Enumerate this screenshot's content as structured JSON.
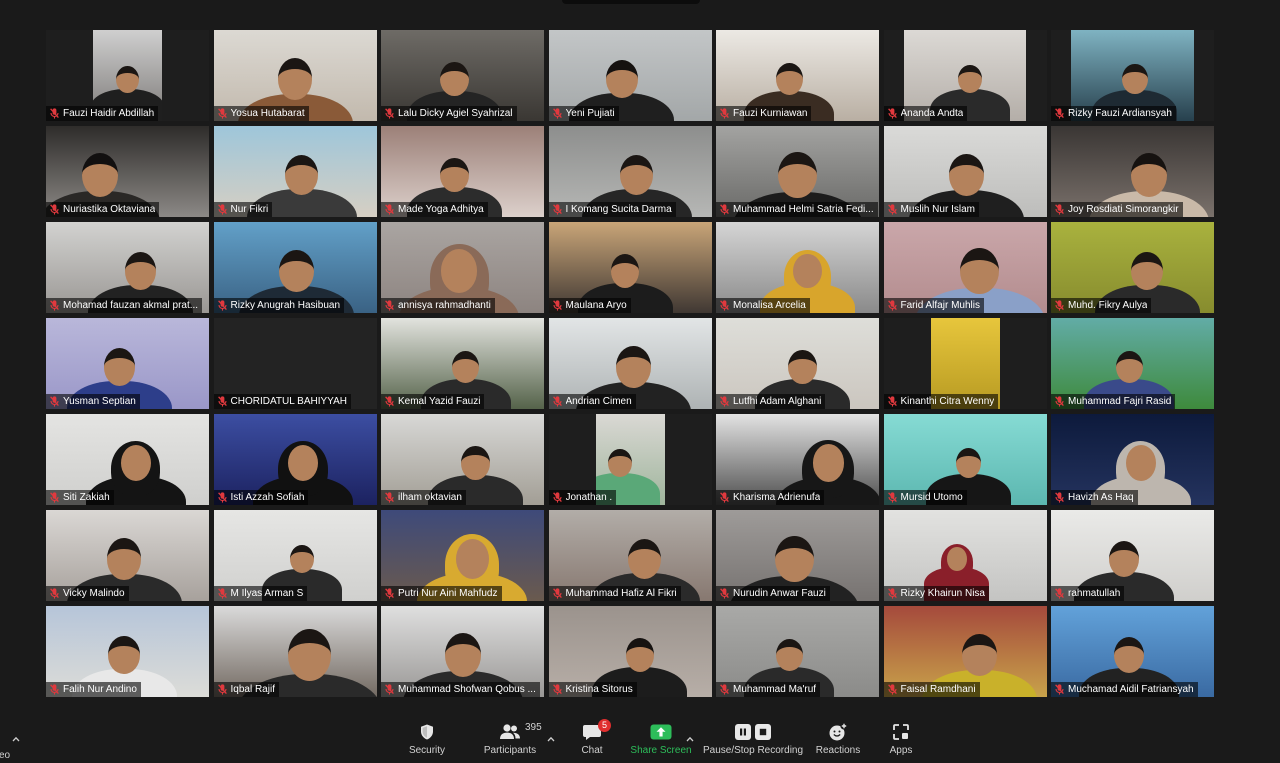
{
  "participants": [
    {
      "name": "Fauzi Haidir Abdillah",
      "muted": true
    },
    {
      "name": "Yosua Hutabarat",
      "muted": true
    },
    {
      "name": "Lalu Dicky Agiel Syahrizal",
      "muted": true
    },
    {
      "name": "Yeni Pujiati",
      "muted": true
    },
    {
      "name": "Fauzi Kurniawan",
      "muted": true
    },
    {
      "name": "Ananda Andta",
      "muted": true
    },
    {
      "name": "Rizky Fauzi Ardiansyah",
      "muted": true
    },
    {
      "name": "Nuriastika Oktaviana",
      "muted": true
    },
    {
      "name": "Nur Fikri",
      "muted": true
    },
    {
      "name": "Made Yoga Adhitya",
      "muted": true
    },
    {
      "name": "I Komang Sucita Darma",
      "muted": true
    },
    {
      "name": "Muhammad Helmi Satria Fedi...",
      "muted": true
    },
    {
      "name": "Muslih Nur Islam",
      "muted": true
    },
    {
      "name": "Joy Rosdiati Simorangkir",
      "muted": true
    },
    {
      "name": "Mohamad fauzan akmal prat...",
      "muted": true
    },
    {
      "name": "Rizky Anugrah Hasibuan",
      "muted": true
    },
    {
      "name": "annisya rahmadhanti",
      "muted": true
    },
    {
      "name": "Maulana Aryo",
      "muted": true
    },
    {
      "name": "Monalisa Arcelia",
      "muted": true
    },
    {
      "name": "Farid Alfajr Muhlis",
      "muted": true
    },
    {
      "name": "Muhd. Fikry Aulya",
      "muted": true
    },
    {
      "name": "Yusman Septian",
      "muted": true
    },
    {
      "name": "CHORIDATUL BAHIYYAH",
      "muted": true
    },
    {
      "name": "Kemal Yazid Fauzi",
      "muted": true
    },
    {
      "name": "Andrian Cimen",
      "muted": true
    },
    {
      "name": "Lutfhi Adam Alghani",
      "muted": true
    },
    {
      "name": "Kinanthi Citra Wenny",
      "muted": true
    },
    {
      "name": "Muhammad Fajri Rasid",
      "muted": true
    },
    {
      "name": "Siti Zakiah",
      "muted": true
    },
    {
      "name": "Isti Azzah Sofiah",
      "muted": true
    },
    {
      "name": "ilham oktavian",
      "muted": true
    },
    {
      "name": "Jonathan .",
      "muted": true
    },
    {
      "name": "Kharisma Adrienufa",
      "muted": true
    },
    {
      "name": "Mursid Utomo",
      "muted": true
    },
    {
      "name": "Havizh As Haq",
      "muted": true
    },
    {
      "name": "Vicky Malindo",
      "muted": true
    },
    {
      "name": "M Ilyas Arman S",
      "muted": true
    },
    {
      "name": "Putri Nur Aini Mahfudz",
      "muted": true
    },
    {
      "name": "Muhammad Hafiz Al Fikri",
      "muted": true
    },
    {
      "name": "Nurudin Anwar Fauzi",
      "muted": true
    },
    {
      "name": "Rizky Khairun Nisa",
      "muted": true
    },
    {
      "name": "rahmatullah",
      "muted": true
    },
    {
      "name": "Falih Nur Andino",
      "muted": true
    },
    {
      "name": "Iqbal Rajif",
      "muted": true
    },
    {
      "name": "Muhammad Shofwan Qobus ...",
      "muted": true
    },
    {
      "name": "Kristina Sitorus",
      "muted": true
    },
    {
      "name": "Muhammad Ma'ruf",
      "muted": true
    },
    {
      "name": "Faisal Ramdhani",
      "muted": true
    },
    {
      "name": "Muchamad Aidil Fatriansyah",
      "muted": true
    }
  ],
  "toolbar": {
    "video": {
      "label": "eo",
      "caret_icon": "chevron-up-icon"
    },
    "security": {
      "label": "Security",
      "icon": "shield-icon"
    },
    "participants": {
      "label": "Participants",
      "icon": "participants-icon",
      "count": 395
    },
    "chat": {
      "label": "Chat",
      "icon": "chat-icon",
      "badge": 5
    },
    "share_screen": {
      "label": "Share Screen",
      "icon": "share-screen-icon"
    },
    "recording": {
      "label": "Pause/Stop Recording",
      "icons": [
        "pause-icon",
        "stop-icon"
      ]
    },
    "reactions": {
      "label": "Reactions",
      "icon": "reactions-icon"
    },
    "apps": {
      "label": "Apps",
      "icon": "apps-icon"
    }
  },
  "colors": {
    "background": "#1a1a1a",
    "share_screen_accent": "#2dbd5a",
    "muted_mic": "#e0393e",
    "chat_badge": "#e02e2e"
  }
}
